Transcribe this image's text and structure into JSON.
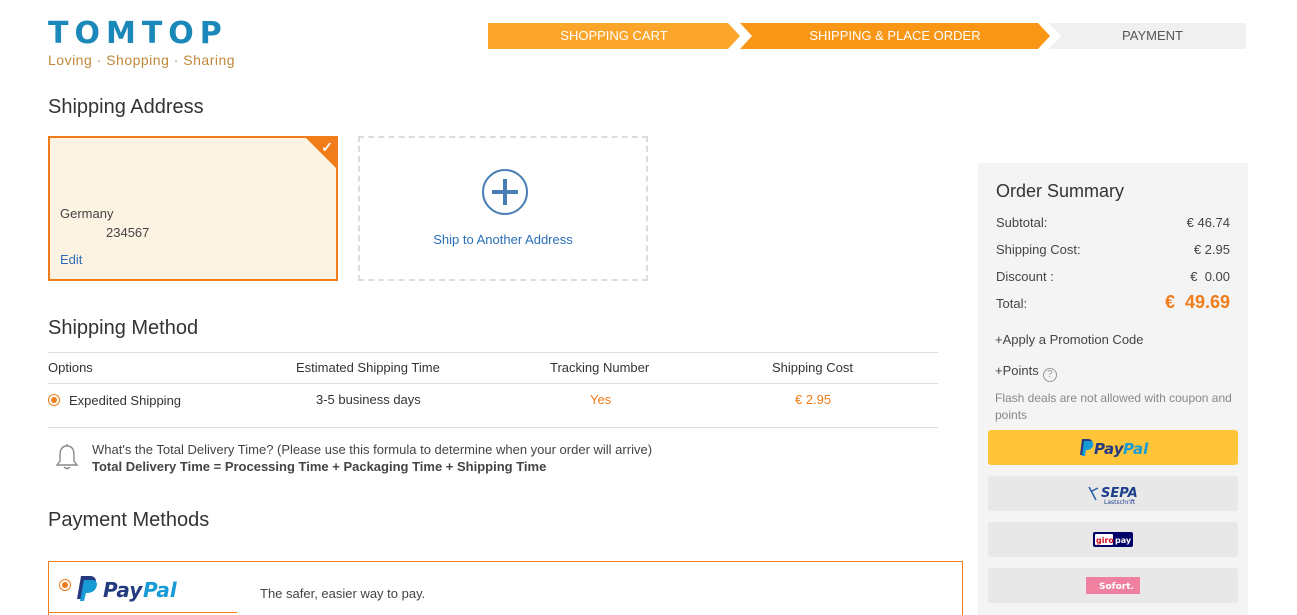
{
  "logo": {
    "name": "TOMTOP",
    "tagline": "Loving · Shopping · Sharing"
  },
  "steps": [
    "SHOPPING CART",
    "SHIPPING & PLACE ORDER",
    "PAYMENT"
  ],
  "shipping_address": {
    "title": "Shipping Address",
    "selected": {
      "country": "Germany",
      "phone": "234567",
      "edit_label": "Edit"
    },
    "add_label": "Ship to Another Address"
  },
  "shipping_method": {
    "title": "Shipping Method",
    "columns": [
      "Options",
      "Estimated Shipping Time",
      "Tracking Number",
      "Shipping Cost"
    ],
    "rows": [
      {
        "option": "Expedited Shipping",
        "time": "3-5 business days",
        "tracking": "Yes",
        "cost": "€ 2.95"
      }
    ],
    "note_question": "What's the Total Delivery Time? (Please use this formula to determine when your order will arrive)",
    "note_formula": "Total Delivery Time = Processing Time + Packaging Time + Shipping Time"
  },
  "payment_methods": {
    "title": "Payment Methods",
    "selected": {
      "name": "PayPal",
      "tagline": "The safer, easier way to pay."
    }
  },
  "order_summary": {
    "title": "Order Summary",
    "subtotal_label": "Subtotal:",
    "subtotal": "€ 46.74",
    "shipping_label": "Shipping Cost:",
    "shipping": "€ 2.95",
    "discount_label": "Discount :",
    "discount": "€  0.00",
    "total_label": "Total:",
    "total": "€  49.69",
    "promo_label": "+Apply a Promotion Code",
    "points_label": "+Points",
    "points_help": "?",
    "flash_note": "Flash deals are not allowed with coupon and points",
    "pay_buttons": [
      {
        "id": "paypal",
        "label": "PayPal"
      },
      {
        "id": "sepa",
        "label": "SEPA",
        "sub": "Lastschrift"
      },
      {
        "id": "giropay",
        "label_a": "giro",
        "label_b": "pay"
      },
      {
        "id": "sofort",
        "label": "Sofort."
      }
    ]
  },
  "colors": {
    "accent": "#f07c1a",
    "step_active": "#f99615",
    "paypal_yellow": "#ffc439",
    "link": "#2a6fb8",
    "logo_blue": "#1a88b8"
  }
}
